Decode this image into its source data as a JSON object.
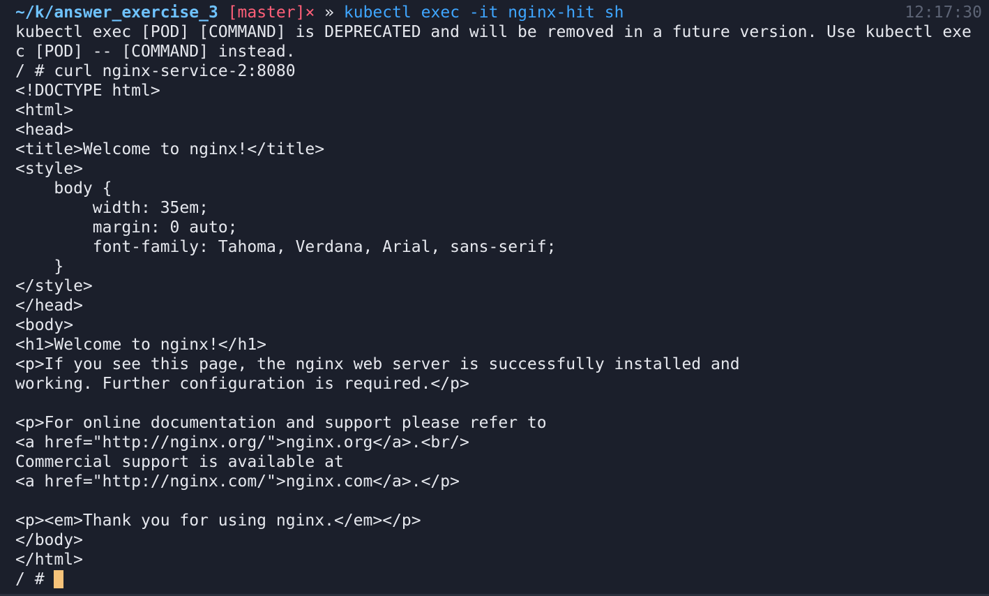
{
  "prompt": {
    "path": "~/k/answer_exercise_3",
    "branch": "[master]",
    "dirty_mark": "×",
    "separator": "»",
    "command": "kubectl exec -it nginx-hit sh"
  },
  "clock": "12:17:30",
  "output_lines": [
    "kubectl exec [POD] [COMMAND] is DEPRECATED and will be removed in a future version. Use kubectl exe",
    "c [POD] -- [COMMAND] instead.",
    "/ # curl nginx-service-2:8080",
    "<!DOCTYPE html>",
    "<html>",
    "<head>",
    "<title>Welcome to nginx!</title>",
    "<style>",
    "    body {",
    "        width: 35em;",
    "        margin: 0 auto;",
    "        font-family: Tahoma, Verdana, Arial, sans-serif;",
    "    }",
    "</style>",
    "</head>",
    "<body>",
    "<h1>Welcome to nginx!</h1>",
    "<p>If you see this page, the nginx web server is successfully installed and",
    "working. Further configuration is required.</p>",
    "",
    "<p>For online documentation and support please refer to",
    "<a href=\"http://nginx.org/\">nginx.org</a>.<br/>",
    "Commercial support is available at",
    "<a href=\"http://nginx.com/\">nginx.com</a>.</p>",
    "",
    "<p><em>Thank you for using nginx.</em></p>",
    "</body>",
    "</html>"
  ],
  "shell_prompt": "/ # ",
  "colors": {
    "background": "#1b1f2b",
    "foreground": "#e6e8ee",
    "path": "#6fc3ff",
    "branch": "#ff5f78",
    "command": "#3fa6ff",
    "clock": "#5d6475",
    "cursor": "#f6c37a"
  }
}
